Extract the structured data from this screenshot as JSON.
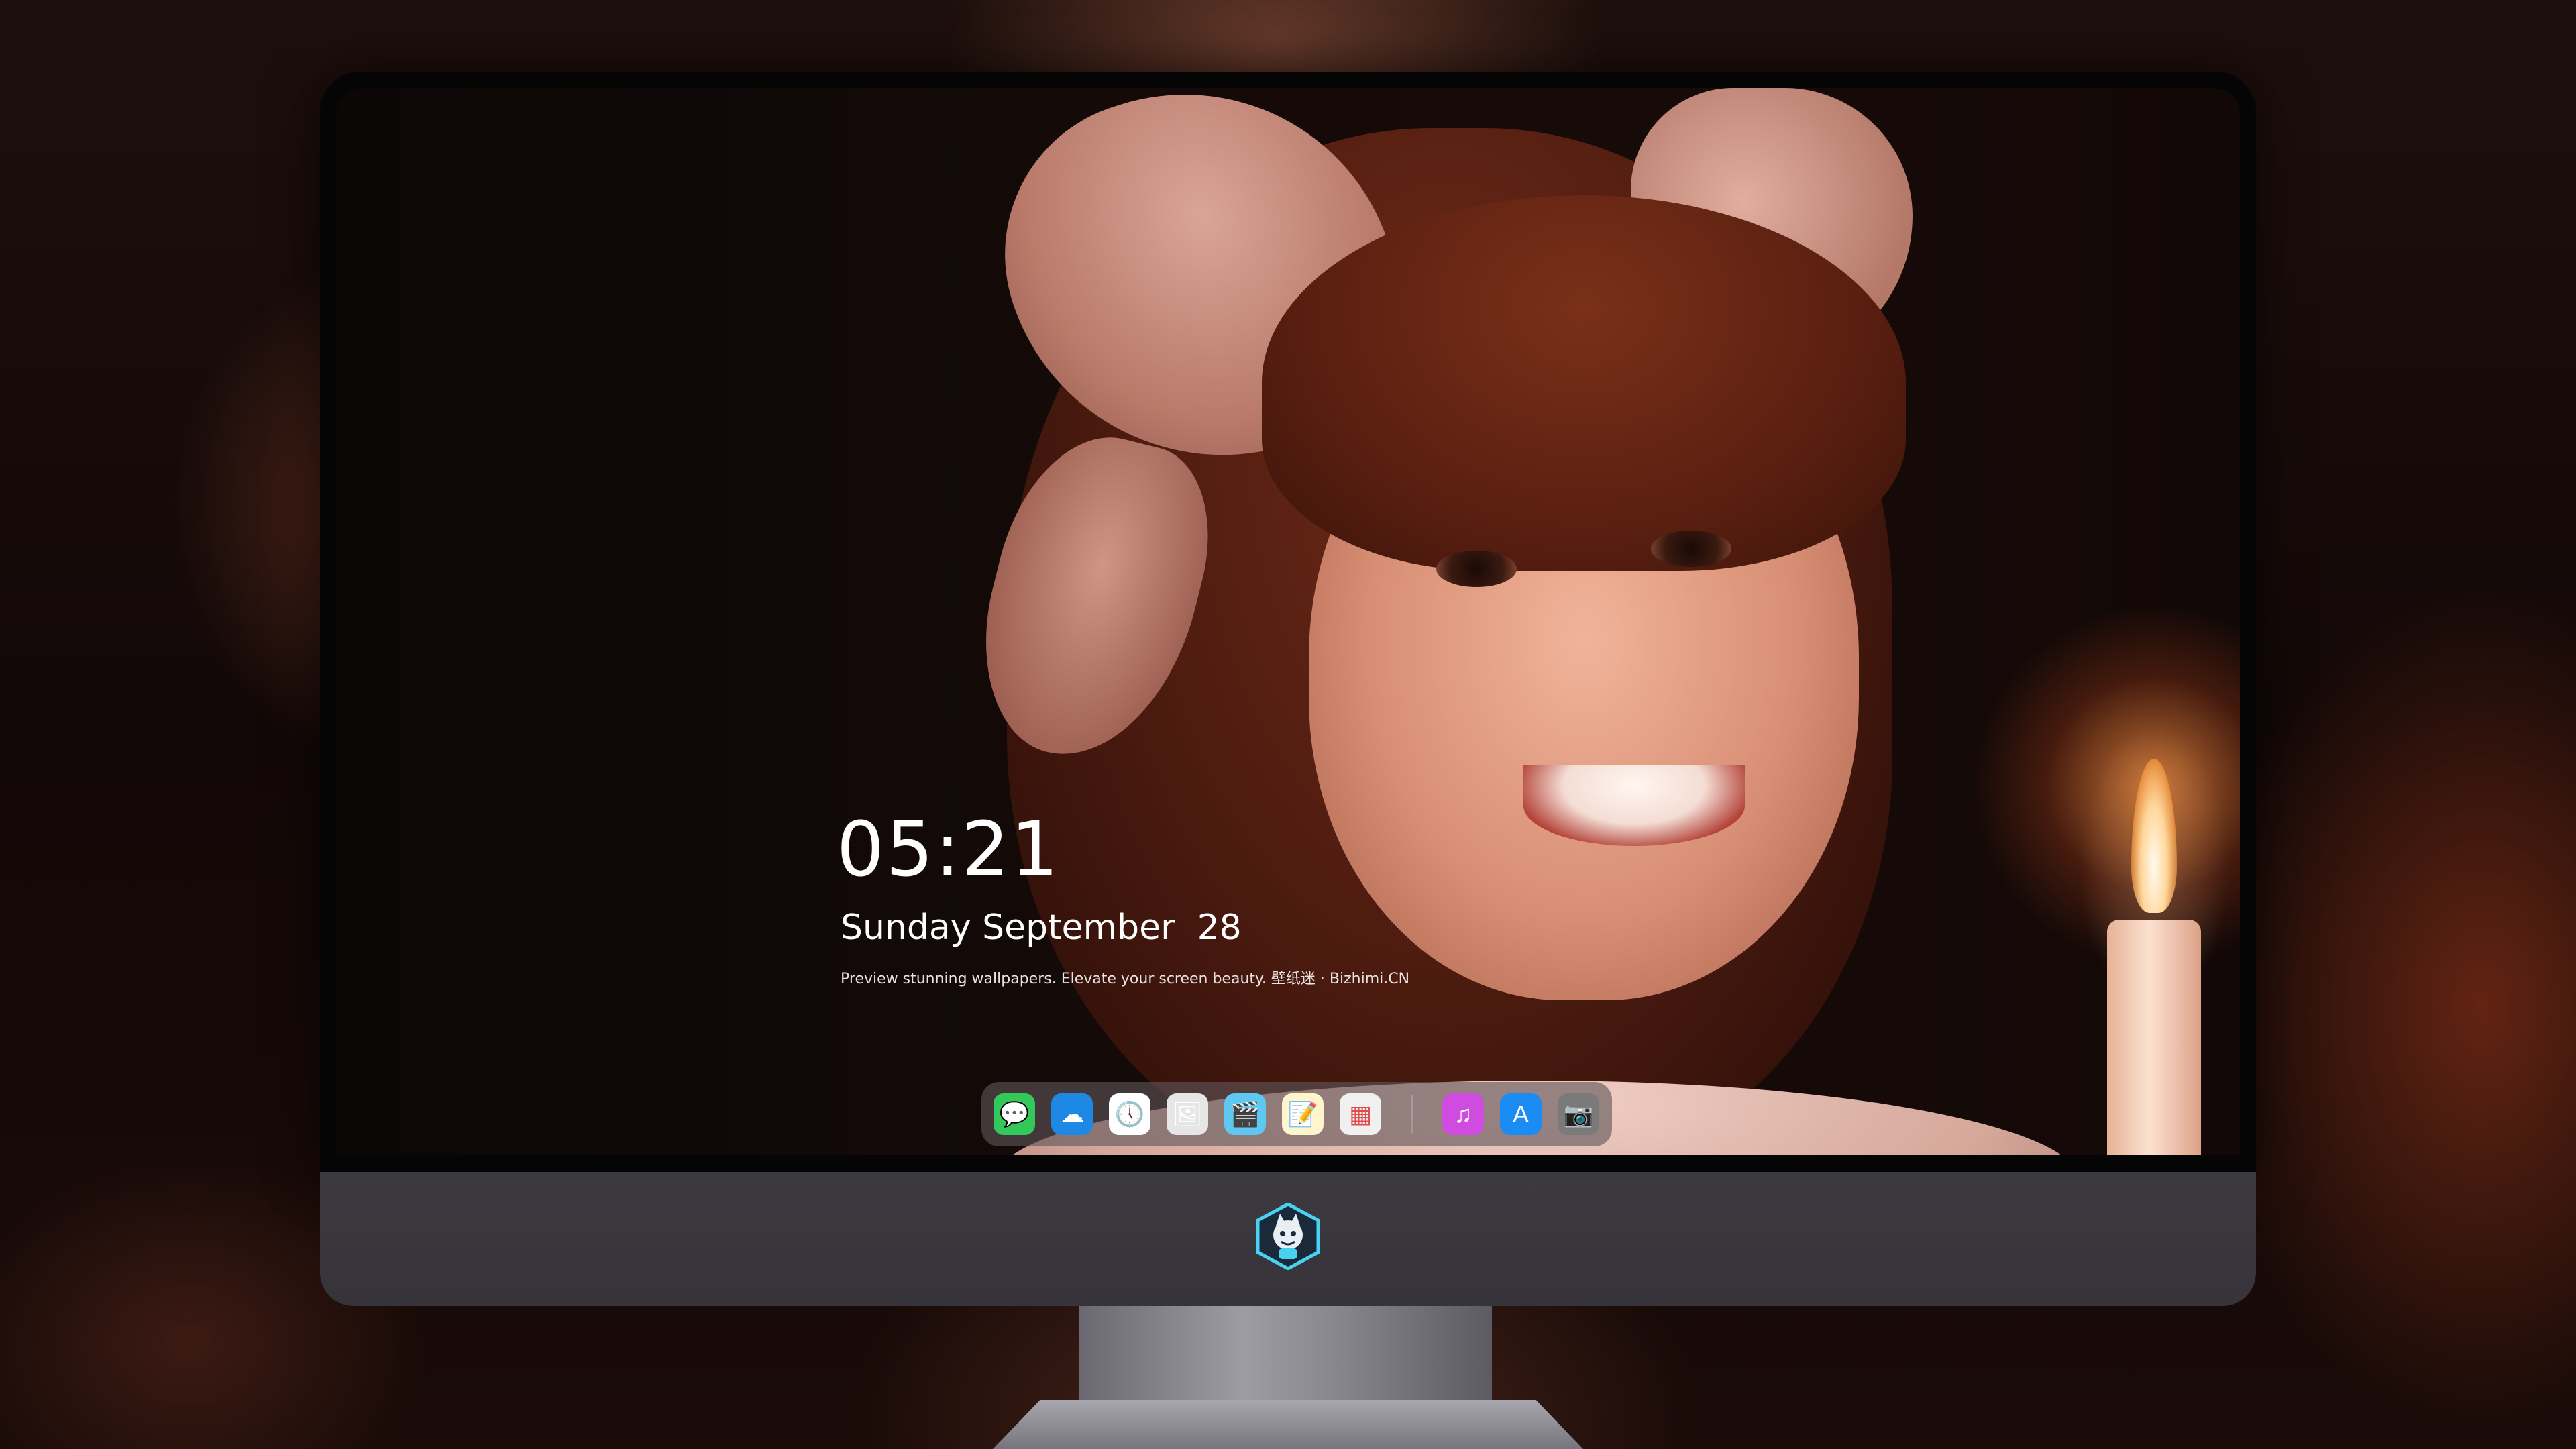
{
  "lock_screen": {
    "time": "05:21",
    "date": "Sunday September  28",
    "tagline": "Preview stunning wallpapers. Elevate your screen beauty. 壁纸迷 · Bizhimi.CN"
  },
  "dock": {
    "apps": [
      {
        "name": "Messages",
        "icon": "messages-icon",
        "glyph": "💬",
        "color": "#34c759"
      },
      {
        "name": "Weather",
        "icon": "weather-icon",
        "glyph": "☁",
        "color": "#1e88e5"
      },
      {
        "name": "Clock",
        "icon": "clock-icon",
        "glyph": "🕔",
        "color": "#ffffff"
      },
      {
        "name": "Preview",
        "icon": "preview-icon",
        "glyph": "🖼",
        "color": "#e6e6e6"
      },
      {
        "name": "Clips",
        "icon": "clips-icon",
        "glyph": "🎬",
        "color": "#5ec8f2"
      },
      {
        "name": "Notes",
        "icon": "notes-icon",
        "glyph": "📝",
        "color": "#fff5cc"
      },
      {
        "name": "Photo Booth",
        "icon": "photobooth-icon",
        "glyph": "▦",
        "color": "#f0f0f0"
      },
      {
        "name": "iTunes",
        "icon": "music-icon",
        "glyph": "♫",
        "color": "#d04ce0"
      },
      {
        "name": "App Store",
        "icon": "appstore-icon",
        "glyph": "A",
        "color": "#1c8cf5"
      },
      {
        "name": "Camera",
        "icon": "camera-icon",
        "glyph": "📷",
        "color": "#7a7a7a"
      }
    ]
  },
  "chin": {
    "logo": "mascot-logo-icon"
  }
}
